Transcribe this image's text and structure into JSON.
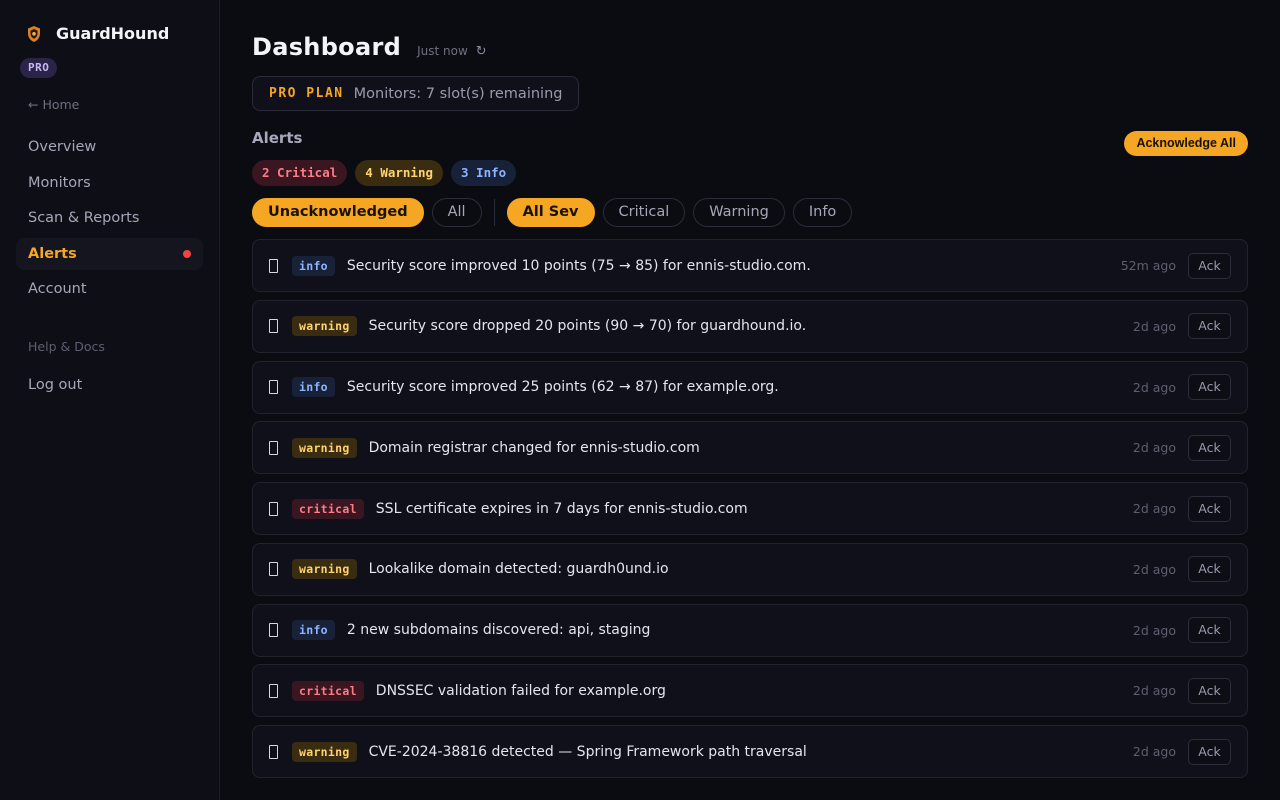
{
  "brand": {
    "name": "GuardHound",
    "badge": "PRO",
    "logo_icon": "shield-logo-icon"
  },
  "colors": {
    "accent": "#f5a623",
    "critical": "#ff7b88",
    "warning": "#ffd36e",
    "info": "#8fb4ff",
    "unread_dot": "#ef4444"
  },
  "sidebar": {
    "home_link": "← Home",
    "items": [
      {
        "label": "Overview",
        "active": false
      },
      {
        "label": "Monitors",
        "active": false
      },
      {
        "label": "Scan & Reports",
        "active": false
      },
      {
        "label": "Alerts",
        "active": true
      },
      {
        "label": "Account",
        "active": false
      }
    ],
    "help": "Help & Docs",
    "logout": "Log out"
  },
  "header": {
    "title": "Dashboard",
    "updated": "Just now",
    "refresh_icon": "↻"
  },
  "plan": {
    "name": "PRO PLAN",
    "text": "Monitors: 7 slot(s) remaining"
  },
  "alerts_section": {
    "title": "Alerts",
    "ack_all": "Acknowledge All",
    "counts": {
      "critical": "2 Critical",
      "warning": "4 Warning",
      "info": "3 Info"
    },
    "status_filters": [
      "Unacknowledged",
      "All"
    ],
    "active_status": "Unacknowledged",
    "severity_filters": [
      "All Sev",
      "Critical",
      "Warning",
      "Info"
    ],
    "active_severity": "All Sev",
    "ack_label": "Ack",
    "items": [
      {
        "severity": "info",
        "message": "Security score improved 10 points (75 → 85) for ennis-studio.com.",
        "time": "52m ago"
      },
      {
        "severity": "warning",
        "message": "Security score dropped 20 points (90 → 70) for guardhound.io.",
        "time": "2d ago"
      },
      {
        "severity": "info",
        "message": "Security score improved 25 points (62 → 87) for example.org.",
        "time": "2d ago"
      },
      {
        "severity": "warning",
        "message": "Domain registrar changed for ennis-studio.com",
        "time": "2d ago"
      },
      {
        "severity": "critical",
        "message": "SSL certificate expires in 7 days for ennis-studio.com",
        "time": "2d ago"
      },
      {
        "severity": "warning",
        "message": "Lookalike domain detected: guardh0und.io",
        "time": "2d ago"
      },
      {
        "severity": "info",
        "message": "2 new subdomains discovered: api, staging",
        "time": "2d ago"
      },
      {
        "severity": "critical",
        "message": "DNSSEC validation failed for example.org",
        "time": "2d ago"
      },
      {
        "severity": "warning",
        "message": "CVE-2024-38816 detected — Spring Framework path traversal",
        "time": "2d ago"
      }
    ]
  }
}
